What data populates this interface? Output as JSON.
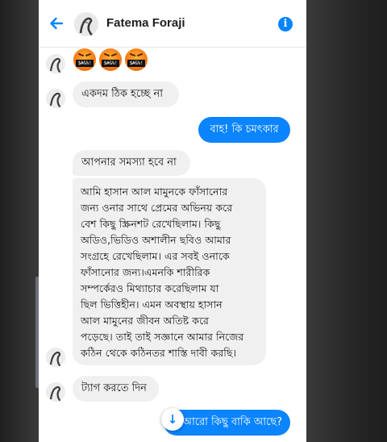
{
  "header": {
    "contact_name": "Fatema Foraji",
    "back_icon": "arrow-left-icon",
    "info_icon": "info-icon",
    "accent_color": "#0084ff"
  },
  "messages": [
    {
      "from": "them",
      "type": "emoji",
      "emoji_name": "face-with-symbols-on-mouth",
      "count": 3,
      "symbols": "$#&%!"
    },
    {
      "from": "them",
      "text": "একদম ঠিক হচ্ছে না"
    },
    {
      "from": "me",
      "text": "বাহ! কি চমৎকার"
    },
    {
      "from": "them",
      "text": "আপনার সমস্যা হবে না"
    },
    {
      "from": "them",
      "text": "আমি হাসান আল মামুনকে ফাঁসানোর\nজন্য ওনার সাথে প্রেমের অভিনয় করে\nবেশ কিছু স্ক্রিনশট রেখেছিলাম। কিছু\nঅডিও,ভিডিও অশালীন ছবিও আমার\nসংগ্রহে রেখেছিলাম। এর সবই ওনাকে\nফাঁসানোর জন্য।এমনকি শারীরিক\nসম্পর্কেরও মিথ্যাচার করেছিলাম যা\nছিল ভিত্তিহীন। এমন অবস্থায়  হাসান\nআল মামুনের জীবন অতিষ্ট করে\nপড়েছে। তাই তাই সজ্ঞানে আমার নিজের\nকঠিন থেকে কঠিনতর শাস্তি দাবী করছি।"
    },
    {
      "from": "them",
      "text": "ট্যাগ করতে দিন"
    },
    {
      "from": "me",
      "text": "আরো কিছু বাকি আছে?"
    }
  ],
  "scroll_button": {
    "icon": "arrow-down-icon",
    "glyph": "↓"
  },
  "colors": {
    "outgoing_bubble": "#0a84ff",
    "incoming_bubble": "#f0f0f0"
  }
}
